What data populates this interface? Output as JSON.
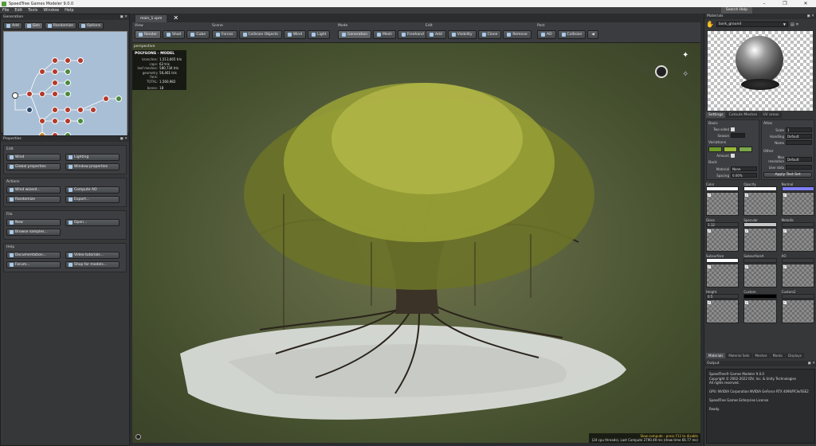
{
  "window": {
    "title": "SpeedTree Games Modeler 9.0.0"
  },
  "menu": [
    "File",
    "Edit",
    "Tools",
    "Window",
    "Help"
  ],
  "search_help": "Search Help",
  "generation": {
    "title": "Generation",
    "tabs": [
      "Add",
      "Gen",
      "Randomize",
      "Options"
    ]
  },
  "properties": {
    "title": "Properties",
    "sections": [
      {
        "title": "Edit",
        "buttons": [
          "Wind",
          "Lighting",
          "Global properties",
          "Window properties"
        ]
      },
      {
        "title": "Actions",
        "buttons": [
          "Wind wizard...",
          "Compute AO",
          "Randomize",
          "Export..."
        ]
      },
      {
        "title": "File",
        "buttons": [
          "New",
          "Open...",
          "Browse samples..."
        ]
      },
      {
        "title": "Help",
        "buttons": [
          "Documentation...",
          "Video tutorials...",
          "Forum...",
          "Shop for models..."
        ]
      }
    ]
  },
  "document_tab": "main_1.spm",
  "toolbar": {
    "groups": [
      {
        "label": "View",
        "buttons": [
          "Render",
          "Shad",
          "Cube"
        ]
      },
      {
        "label": "Scene",
        "buttons": [
          "Forces",
          "Collision Objects",
          "Wind",
          "Light"
        ]
      },
      {
        "label": "Mode",
        "buttons": [
          "Generation",
          "Mesh",
          "Freehand"
        ]
      },
      {
        "label": "Edit",
        "buttons": [
          "Add",
          "Visibility",
          "Clone",
          "Remove"
        ]
      },
      {
        "label": "Post",
        "buttons": [
          "AO",
          "Collision"
        ]
      }
    ]
  },
  "viewport": {
    "label": "perspective",
    "stats": {
      "header": "POLYGONS - MODEL",
      "rows": [
        {
          "k": "branches:",
          "v": "1,513,665 tris"
        },
        {
          "k": "caps:",
          "v": "62 tris"
        },
        {
          "k": "leaf meshes:",
          "v": "580,734 tris"
        },
        {
          "k": "geometry fans:",
          "v": "56,461 tris"
        },
        {
          "k": "TOTAL:",
          "v": "1,560,982"
        },
        {
          "k": "bones:",
          "v": "18"
        }
      ]
    },
    "footer": {
      "line1": "Slow compute - press F11 to disable",
      "line2": "(24 cpu threads), Last Compute 2790.49 ms (draw time 66.77 ms)"
    }
  },
  "materials": {
    "title": "Materials",
    "selected": "bark_ground",
    "subtabs": [
      "Settings",
      "Cutouts Meshes",
      "UV areas"
    ],
    "basic": {
      "title": "Basic",
      "two_sided": "Two-sided",
      "season": "Season"
    },
    "variations": {
      "title": "Variations",
      "amount": "Amount"
    },
    "back": {
      "title": "Back",
      "material": "Material",
      "material_value": "None",
      "spacing": "Spacing",
      "spacing_value": "0.00%"
    },
    "atlas": {
      "title": "Atlas",
      "scale_label": "Scale",
      "scale_value": "1",
      "handling_label": "Handling",
      "handling_value": "Default",
      "name_label": "Name"
    },
    "other": {
      "title": "Other",
      "max_res_label": "Max resolution",
      "max_res_value": "Default",
      "user_data_label": "User data",
      "apply_btn": "Apply Text Set"
    },
    "swatch_colors": [
      "#6e9a2a",
      "#9ab83a",
      "#7aa84a"
    ],
    "textures": [
      {
        "label": "Color",
        "value": ""
      },
      {
        "label": "Opacity",
        "value": ""
      },
      {
        "label": "Normal",
        "value": ""
      },
      {
        "label": "Gloss",
        "value": "1.12"
      },
      {
        "label": "Specular",
        "value": ""
      },
      {
        "label": "Metallic",
        "value": ""
      },
      {
        "label": "Subsurface",
        "value": ""
      },
      {
        "label": "SubsurfaceA",
        "value": ""
      },
      {
        "label": "AO",
        "value": ""
      },
      {
        "label": "Height",
        "value": "0.5"
      },
      {
        "label": "Custom",
        "value": ""
      },
      {
        "label": "Custom2",
        "value": ""
      }
    ],
    "bottom_tabs": [
      "Materials",
      "Material Sets",
      "Meshes",
      "Masks",
      "Displays"
    ]
  },
  "output": {
    "title": "Output",
    "lines": [
      "SpeedTree® Games Modeler 9.0.0",
      "Copyright © 2002-2022 IDV, Inc. & Unity Technologies",
      "All rights reserved.",
      "",
      "GPU: NVIDIA Corporation NVIDIA GeForce RTX 4090/PCIe/SSE2",
      "",
      "SpeedTree Games Enterprise License",
      "",
      "Ready."
    ]
  }
}
